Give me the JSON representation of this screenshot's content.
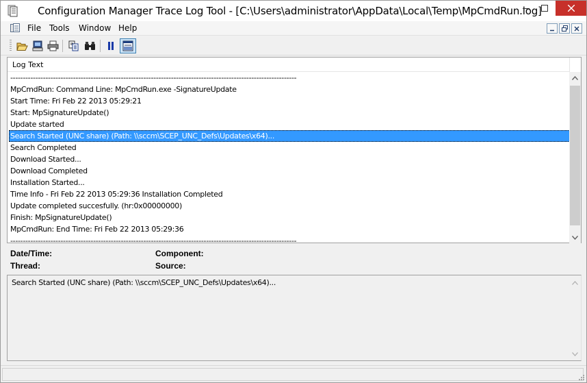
{
  "window": {
    "title": "Configuration Manager Trace Log Tool - [C:\\Users\\administrator\\AppData\\Local\\Temp\\MpCmdRun.log]",
    "close_color": "#c7302a"
  },
  "menu": {
    "items": [
      "File",
      "Tools",
      "Window",
      "Help"
    ]
  },
  "toolbar": {
    "buttons": [
      "open-icon",
      "open-on-server-icon",
      "print-icon",
      "copy-icon",
      "find-icon",
      "pause-icon",
      "toggle-details-icon"
    ]
  },
  "log": {
    "column_header": "Log Text",
    "selected_index": 5,
    "selection_color": "#3399ff",
    "rows": [
      "------------------------------------------------------------------------------------------------------------------",
      "MpCmdRun: Command Line: MpCmdRun.exe  -SignatureUpdate",
      " Start Time: Fri Feb 22 2013 05:29:21",
      "Start: MpSignatureUpdate()",
      "Update started",
      "Search Started (UNC share) (Path: \\\\sccm\\SCEP_UNC_Defs\\Updates\\x64)...",
      "Search Completed",
      "Download Started...",
      "Download Completed",
      "Installation Started...",
      "Time Info - Fri Feb 22 2013 05:29:36 Installation Completed",
      "Update completed succesfully. (hr:0x00000000)",
      "Finish: MpSignatureUpdate()",
      "MpCmdRun: End Time: Fri Feb 22 2013 05:29:36",
      "------------------------------------------------------------------------------------------------------------------"
    ]
  },
  "details": {
    "datetime_label": "Date/Time:",
    "component_label": "Component:",
    "thread_label": "Thread:",
    "source_label": "Source:",
    "datetime_value": "",
    "component_value": "",
    "thread_value": "",
    "source_value": "",
    "message": "Search Started (UNC share) (Path: \\\\sccm\\SCEP_UNC_Defs\\Updates\\x64)..."
  },
  "status": {
    "text": ""
  }
}
